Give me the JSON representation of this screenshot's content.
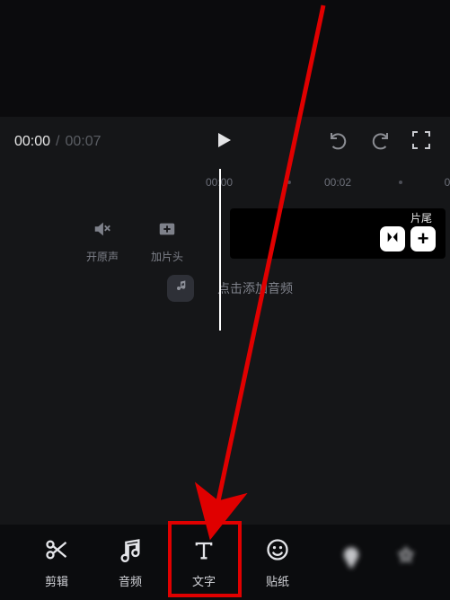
{
  "playback": {
    "current_time": "00:00",
    "separator": "/",
    "total_time": "00:07"
  },
  "ruler": {
    "labels": [
      "00:00",
      "00:02"
    ]
  },
  "side_controls": {
    "original_sound": {
      "label": "开原声"
    },
    "add_intro": {
      "label": "加片头"
    }
  },
  "clip_track": {
    "end_label": "片尾"
  },
  "audio_row": {
    "hint": "点击添加音频"
  },
  "toolbar": {
    "items": [
      {
        "id": "edit",
        "label": "剪辑"
      },
      {
        "id": "audio",
        "label": "音频"
      },
      {
        "id": "text",
        "label": "文字"
      },
      {
        "id": "sticker",
        "label": "贴纸"
      },
      {
        "id": "overlay",
        "label": ""
      },
      {
        "id": "effect",
        "label": ""
      }
    ]
  }
}
